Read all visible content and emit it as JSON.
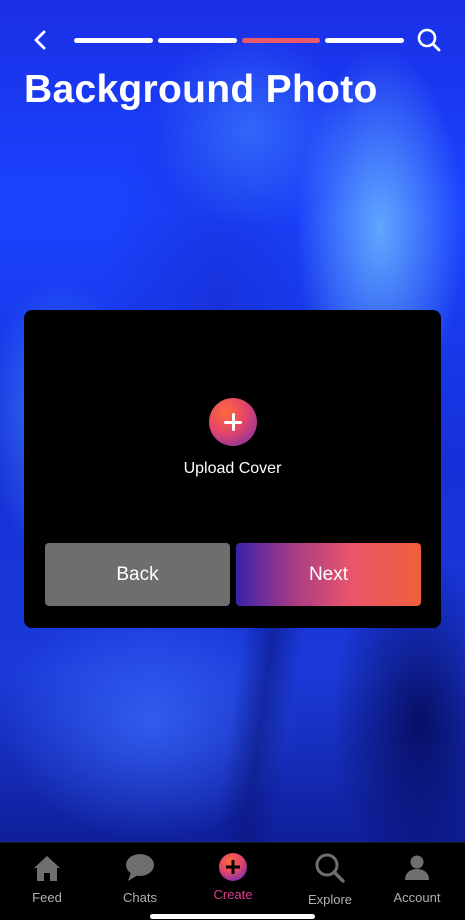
{
  "header": {
    "title": "Background Photo",
    "progress_steps": 4,
    "active_step": 3
  },
  "card": {
    "upload_label": "Upload Cover",
    "back_label": "Back",
    "next_label": "Next"
  },
  "nav": {
    "items": [
      {
        "label": "Feed",
        "icon": "home-icon"
      },
      {
        "label": "Chats",
        "icon": "chat-bubble-icon"
      },
      {
        "label": "Create",
        "icon": "plus-circle-icon"
      },
      {
        "label": "Explore",
        "icon": "search-icon"
      },
      {
        "label": "Account",
        "icon": "person-icon"
      }
    ],
    "active": "Create"
  },
  "colors": {
    "accent_pink": "#e8596b",
    "create_label": "#e23b8d",
    "next_gradient": [
      "#3b22a8",
      "#e9566c",
      "#ef5f3c"
    ],
    "back_button": "#6e6e6e"
  }
}
